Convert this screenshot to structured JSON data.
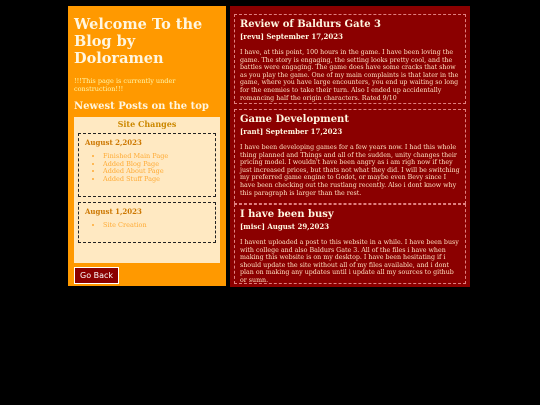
{
  "sidebar": {
    "title": "Welcome To the Blog by Doloramen",
    "notice": "!!!This page is currently under construction!!!",
    "newest_heading": "Newest Posts on the top",
    "site_changes": {
      "title": "Site Changes",
      "groups": [
        {
          "date": "August 2,2023",
          "items": [
            "Finished Main Page",
            "Added Blog Page",
            "Added About Page",
            "Added Stuff Page"
          ]
        },
        {
          "date": "August 1,2023",
          "items": [
            "Site Creation"
          ]
        }
      ]
    },
    "go_back_label": "Go Back"
  },
  "posts": [
    {
      "title": "Review of Baldurs Gate 3",
      "meta": "[revu] September 17,2023",
      "body": "I have, at this point, 100 hours in the game. I have been loving the game. The story is engaging, the setting looks pretty cool, and the battles were engaging. The game does have some cracks that show as you play the game. One of my main complaints is that later in the game, where you have large encounters, you end up waiting so long for the enemies to take their turn. Also I ended up accidentally romancing half the origin characters. Rated 9/10"
    },
    {
      "title": "Game Development",
      "meta": "[rant] September 17,2023",
      "body": "I have been developing games for a few years now. I had this whole thing planned and Things and all of the sudden, unity changes their pricing model. I wouldn't have been angry as i am righ now if they just increased prices, but thats not what they did. I will be switching my preferred game engine to Godot, or maybe even Bevy since I have been checking out the rustlang recently. Also i dont know why this paragraph is larger than the rest."
    },
    {
      "title": "I have been busy",
      "meta": "[misc] August 29,2023",
      "body": "I havent uploaded a post to this website in a while. I have been busy with college and also Baldurs Gate 3. All of the files i have when making this website is on my desktop. I have been hesitating if i should update the site without all of my files available, and i dont plan on making any updates until i update all my sources to github or sumn."
    }
  ]
}
